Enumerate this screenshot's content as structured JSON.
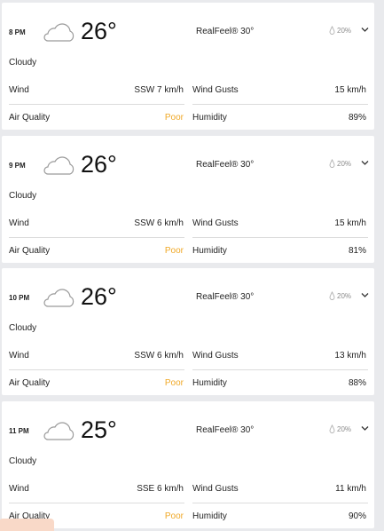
{
  "hours": [
    {
      "time": "8 PM",
      "temp": "26°",
      "realfeel": "RealFeel® 30°",
      "precip": "20%",
      "condition": "Cloudy",
      "wind_label": "Wind",
      "wind": "SSW 7 km/h",
      "gusts_label": "Wind Gusts",
      "gusts": "15 km/h",
      "aq_label": "Air Quality",
      "aq": "Poor",
      "humidity_label": "Humidity",
      "humidity": "89%"
    },
    {
      "time": "9 PM",
      "temp": "26°",
      "realfeel": "RealFeel® 30°",
      "precip": "20%",
      "condition": "Cloudy",
      "wind_label": "Wind",
      "wind": "SSW 6 km/h",
      "gusts_label": "Wind Gusts",
      "gusts": "15 km/h",
      "aq_label": "Air Quality",
      "aq": "Poor",
      "humidity_label": "Humidity",
      "humidity": "81%"
    },
    {
      "time": "10 PM",
      "temp": "26°",
      "realfeel": "RealFeel® 30°",
      "precip": "20%",
      "condition": "Cloudy",
      "wind_label": "Wind",
      "wind": "SSW 6 km/h",
      "gusts_label": "Wind Gusts",
      "gusts": "13 km/h",
      "aq_label": "Air Quality",
      "aq": "Poor",
      "humidity_label": "Humidity",
      "humidity": "88%"
    },
    {
      "time": "11 PM",
      "temp": "25°",
      "realfeel": "RealFeel® 30°",
      "precip": "20%",
      "condition": "Cloudy",
      "wind_label": "Wind",
      "wind": "SSE 6 km/h",
      "gusts_label": "Wind Gusts",
      "gusts": "11 km/h",
      "aq_label": "Air Quality",
      "aq": "Poor",
      "humidity_label": "Humidity",
      "humidity": "90%"
    }
  ],
  "icons": {
    "condition": "cloud-icon",
    "precip": "raindrop-icon",
    "expand": "chevron-down-icon"
  },
  "colors": {
    "air_quality_poor": "#f0a826",
    "card_bg": "#ffffff",
    "page_bg": "#e9eaed"
  }
}
